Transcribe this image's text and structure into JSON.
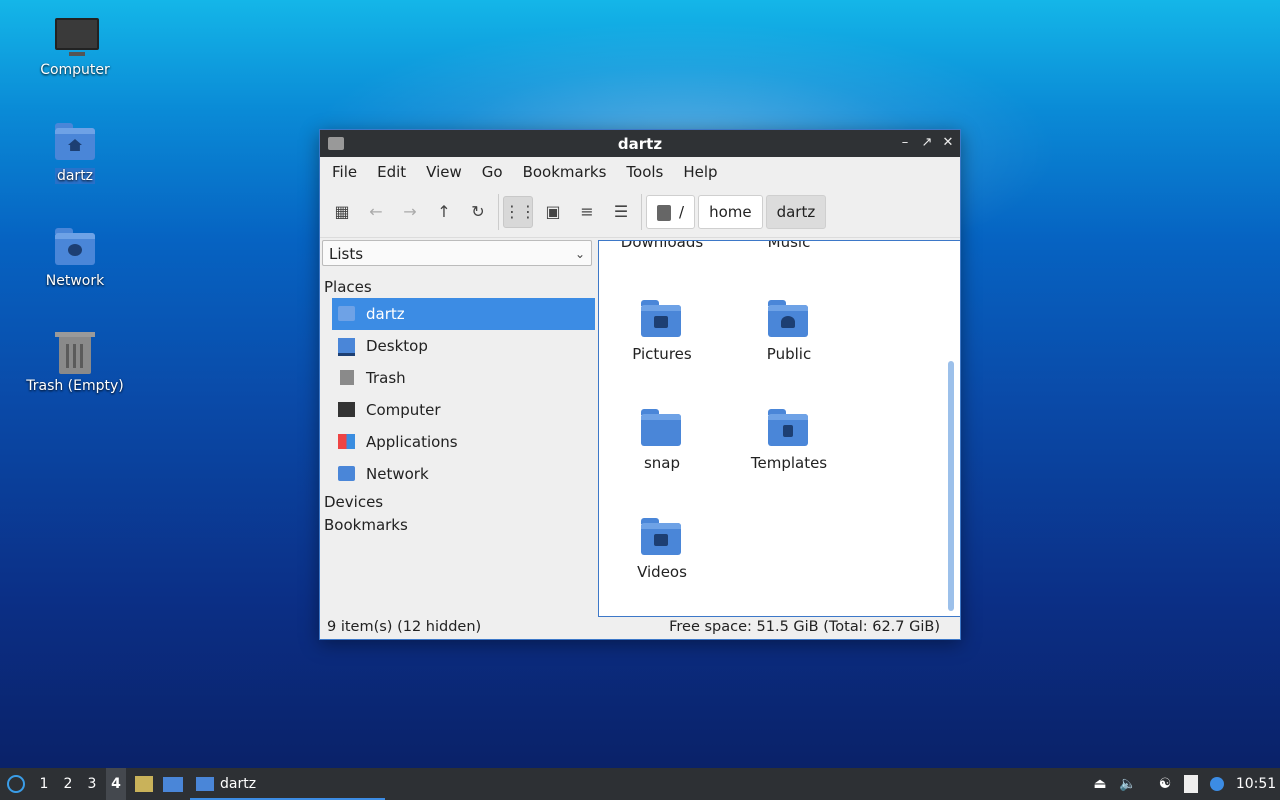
{
  "desktop": {
    "icons": [
      {
        "label": "Computer"
      },
      {
        "label": "dartz"
      },
      {
        "label": "Network"
      },
      {
        "label": "Trash (Empty)"
      }
    ]
  },
  "window": {
    "title": "dartz",
    "menu": [
      "File",
      "Edit",
      "View",
      "Go",
      "Bookmarks",
      "Tools",
      "Help"
    ],
    "breadcrumb": [
      "/",
      "home",
      "dartz"
    ],
    "sidebar": {
      "selector": "Lists",
      "places_heading": "Places",
      "places": [
        "dartz",
        "Desktop",
        "Trash",
        "Computer",
        "Applications",
        "Network"
      ],
      "devices_heading": "Devices",
      "bookmarks_heading": "Bookmarks"
    },
    "files": {
      "partial": [
        "Downloads",
        "Music"
      ],
      "items": [
        "Pictures",
        "Public",
        "snap",
        "Templates",
        "Videos"
      ]
    },
    "status": {
      "items": "9 item(s) (12 hidden)",
      "space": "Free space: 51.5 GiB (Total: 62.7 GiB)"
    }
  },
  "taskbar": {
    "workspaces": [
      "1",
      "2",
      "3",
      "4"
    ],
    "task_label": "dartz",
    "clock": "10:51"
  },
  "colors": {
    "accent": "#3c8ce4",
    "folder": "#4a86d8",
    "titlebar": "#2f3235"
  }
}
